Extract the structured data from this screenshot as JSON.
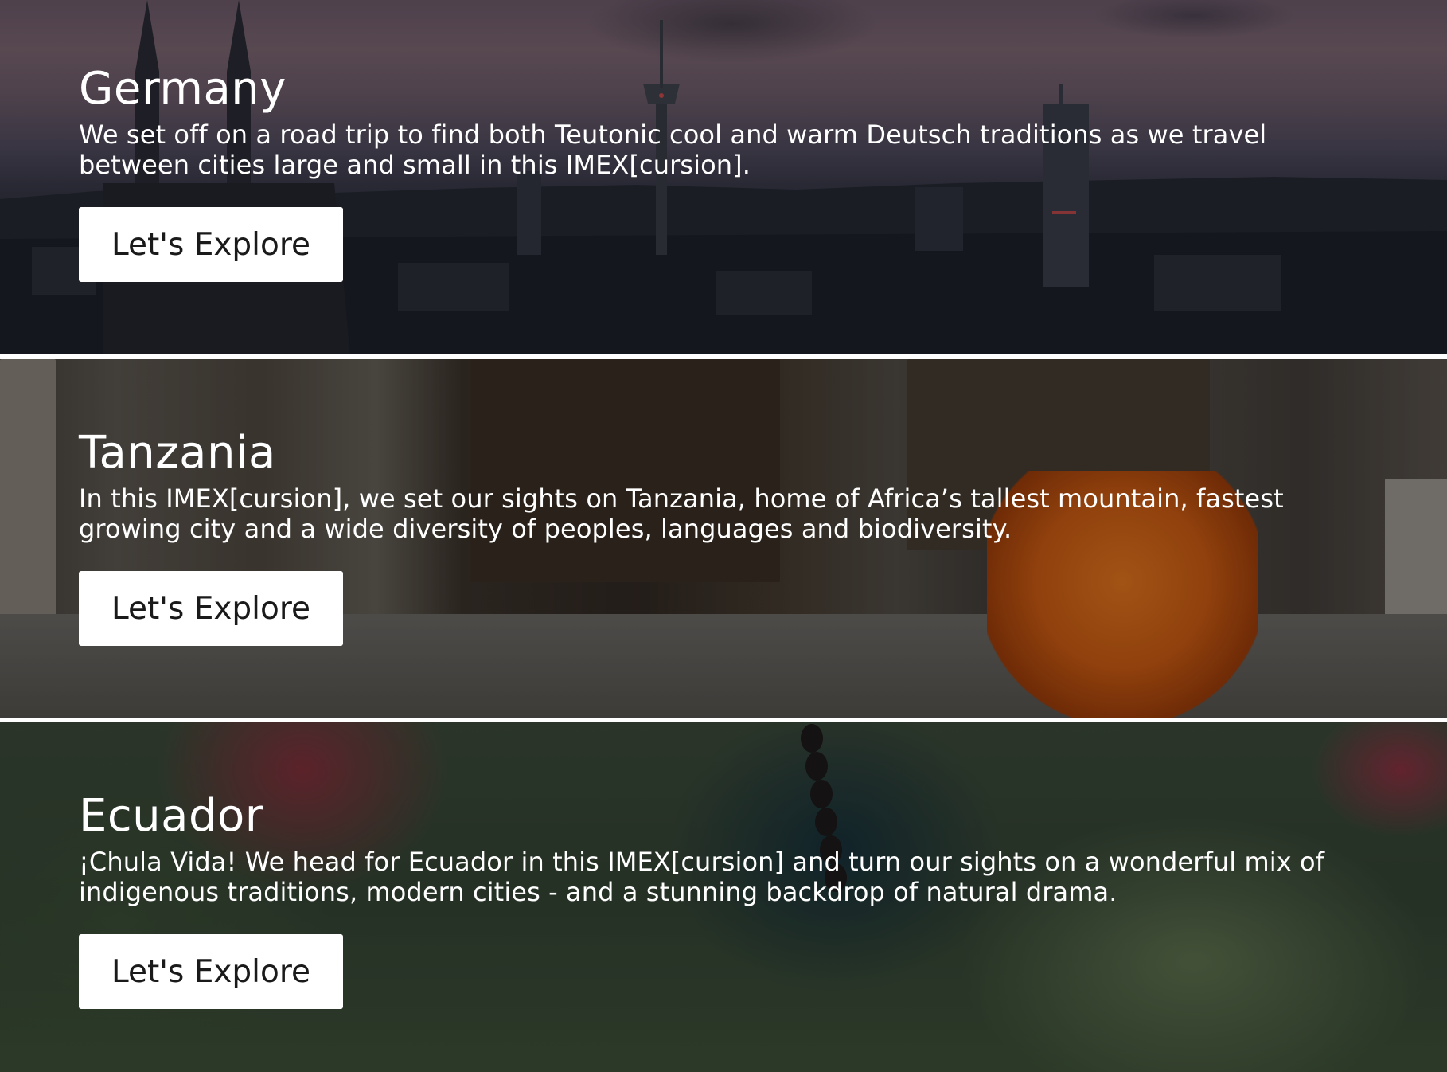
{
  "destinations": [
    {
      "title": "Germany",
      "description": "We set off on a road trip to find both Teutonic cool and warm Deutsch traditions as we travel between cities large and small in this IMEX[cursion].",
      "button_label": "Let's Explore"
    },
    {
      "title": "Tanzania",
      "description": "In this IMEX[cursion], we set our sights on Tanzania, home of Africa’s tallest mountain, fastest growing city and a wide diversity of peoples, languages and biodiversity.",
      "button_label": "Let's Explore"
    },
    {
      "title": "Ecuador",
      "description": "¡Chula Vida! We head for Ecuador in this IMEX[cursion] and turn our sights on a wonderful mix of indigenous traditions, modern cities - and a stunning backdrop of natural drama.",
      "button_label": "Let's Explore"
    }
  ],
  "colors": {
    "button_background": "#ffffff",
    "button_text": "#1a1a1a",
    "heading_text": "#ffffff",
    "divider": "#ffffff"
  }
}
